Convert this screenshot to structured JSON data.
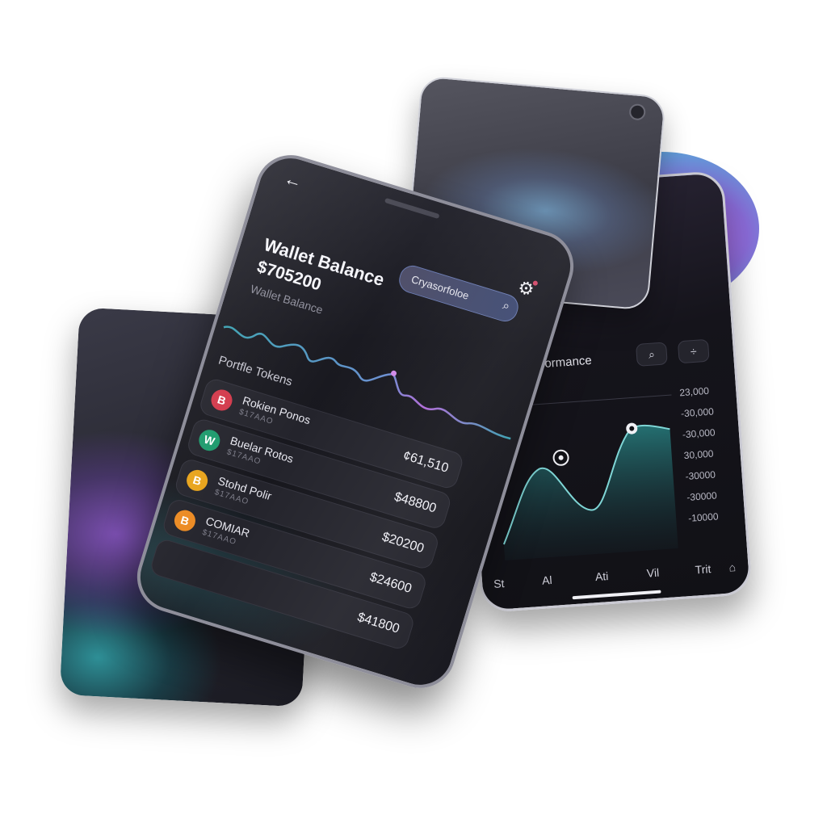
{
  "main_phone": {
    "search_label": "Cryasorfoloe",
    "title": "Wallet Balance",
    "balance": "$705200",
    "subtitle": "Wallet Balance",
    "section_label": "Portfle Tokens",
    "tokens": [
      {
        "logo": "B",
        "name": "Rokien Ponos",
        "sub": "$17AAO",
        "value": "¢61,510",
        "color": "#d2384a"
      },
      {
        "logo": "W",
        "name": "Buelar Rotos",
        "sub": "$17AAO",
        "value": "$48800",
        "color": "#1c9a6c"
      },
      {
        "logo": "B",
        "name": "Stohd Polir",
        "sub": "$17AAO",
        "value": "$20200",
        "color": "#e8a31a"
      },
      {
        "logo": "B",
        "name": "COMIAR",
        "sub": "$17AAO",
        "value": "$24600",
        "color": "#ec8a22"
      },
      {
        "logo": "",
        "name": "",
        "sub": "",
        "value": "$41800",
        "color": ""
      }
    ]
  },
  "right_phone": {
    "title": "ormance",
    "y_labels": [
      "23,000",
      "-30,000",
      "-30,000",
      "30,000",
      "-30000",
      "-30000",
      "-10000"
    ],
    "tabs": [
      "St",
      "Al",
      "Ati",
      "Vil",
      "Trit"
    ]
  },
  "icons": {
    "back": "back-arrow-icon",
    "settings": "gear-icon",
    "search": "search-icon",
    "divide": "divide-icon",
    "bank": "bank-icon"
  }
}
